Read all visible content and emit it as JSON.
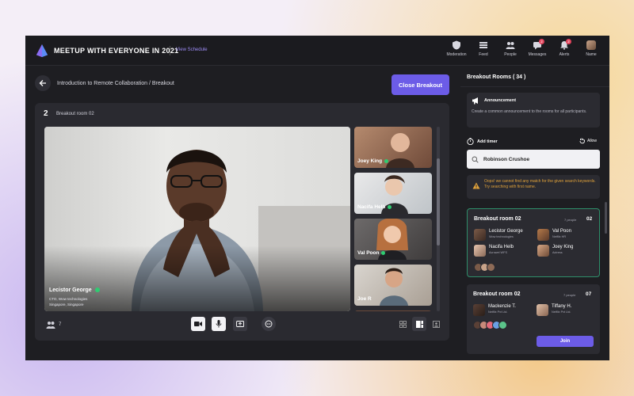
{
  "header": {
    "title": "MEETUP WITH EVERYONE IN 2021",
    "view_schedule": "View Schedule",
    "nav": [
      {
        "label": "Moderation",
        "icon": "shield-icon",
        "badge": ""
      },
      {
        "label": "Feed",
        "icon": "feed-icon",
        "badge": ""
      },
      {
        "label": "People",
        "icon": "people-icon",
        "badge": ""
      },
      {
        "label": "Messages",
        "icon": "messages-icon",
        "badge": "2"
      },
      {
        "label": "Alerts",
        "icon": "bell-icon",
        "badge": "2"
      },
      {
        "label": "Name",
        "icon": "avatar",
        "badge": ""
      }
    ]
  },
  "main": {
    "breadcrumb": "Introduction to Remote Collaboration / Breakout",
    "close_button": "Close Breakout",
    "room_number": "2",
    "room_name": "Breakout room 02",
    "speaker": {
      "name": "Lecistor George",
      "role": "CTO, Wow technologies",
      "location": "Singapore, Singapore"
    },
    "thumbnails": [
      {
        "name": "Joey King"
      },
      {
        "name": "Nacifa Helb"
      },
      {
        "name": "Val Poon"
      },
      {
        "name": "Joe R"
      }
    ],
    "participant_count": "7"
  },
  "sidebar": {
    "title": "Breakout Rooms ( 34 )",
    "announcement_title": "Announcement",
    "announcement_text": "Create a common announcement to the rooms for all participants.",
    "add_timer": "Add timer",
    "allow": "Allow",
    "search_value": "Robinson Crushoe",
    "warning": "Oops! we cannot find any match for the given search keywords. Try searching with first name.",
    "rooms": [
      {
        "title": "Breakout room 02",
        "people": "7 people",
        "number": "02",
        "members": [
          {
            "name": "Lecistor George",
            "sub": "Wow technologies"
          },
          {
            "name": "Val Poon",
            "sub": "Netflix HR"
          },
          {
            "name": "Nacifa Helb",
            "sub": "Acrowel WFS"
          },
          {
            "name": "Joey King",
            "sub": "Actress"
          }
        ]
      },
      {
        "title": "Breakout room 02",
        "people": "7 people",
        "number": "07",
        "members": [
          {
            "name": "Mackenzie T.",
            "sub": "Netflix Pvt Ltd."
          },
          {
            "name": "Tiffany H.",
            "sub": "Netflix Pvt Ltd."
          }
        ],
        "join": "Join"
      }
    ]
  },
  "colors": {
    "accent": "#6c5ce7",
    "speaking": "#2ecc71",
    "warning": "#e0a23a",
    "badge": "#e2445c"
  }
}
